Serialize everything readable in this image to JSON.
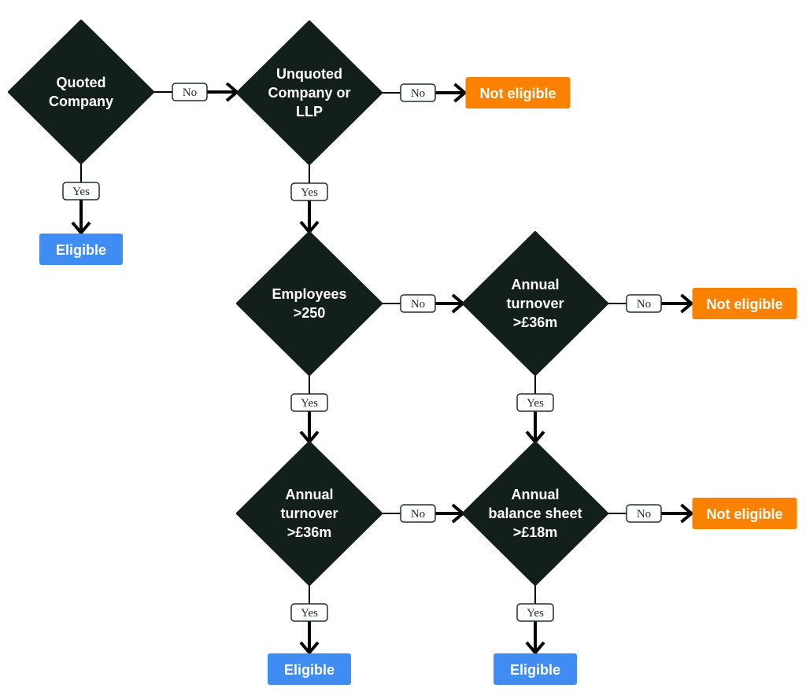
{
  "colors": {
    "decision": "#13201a",
    "eligible": "#3f8cf3",
    "not_eligible": "#fb8200",
    "connector": "#000000",
    "label_border": "#1e3328",
    "label_fill": "#ffffff"
  },
  "labels": {
    "yes": "Yes",
    "no": "No"
  },
  "nodes": [
    {
      "id": "quoted",
      "type": "decision",
      "lines": [
        "Quoted",
        "Company"
      ]
    },
    {
      "id": "unquoted",
      "type": "decision",
      "lines": [
        "Unquoted",
        "Company or",
        "LLP"
      ]
    },
    {
      "id": "employees",
      "type": "decision",
      "lines": [
        "Employees",
        ">250"
      ]
    },
    {
      "id": "turnover_right",
      "type": "decision",
      "lines": [
        "Annual",
        "turnover",
        ">£36m"
      ]
    },
    {
      "id": "turnover_left",
      "type": "decision",
      "lines": [
        "Annual",
        "turnover",
        ">£36m"
      ]
    },
    {
      "id": "balance",
      "type": "decision",
      "lines": [
        "Annual",
        "balance sheet",
        ">£18m"
      ]
    },
    {
      "id": "eligible_1",
      "type": "eligible",
      "label": "Eligible"
    },
    {
      "id": "not_eligible_1",
      "type": "not_eligible",
      "label": "Not eligible"
    },
    {
      "id": "not_eligible_2",
      "type": "not_eligible",
      "label": "Not eligible"
    },
    {
      "id": "not_eligible_3",
      "type": "not_eligible",
      "label": "Not eligible"
    },
    {
      "id": "eligible_2",
      "type": "eligible",
      "label": "Eligible"
    },
    {
      "id": "eligible_3",
      "type": "eligible",
      "label": "Eligible"
    }
  ],
  "edges": [
    {
      "from": "quoted",
      "to": "unquoted",
      "answer": "no"
    },
    {
      "from": "quoted",
      "to": "eligible_1",
      "answer": "yes"
    },
    {
      "from": "unquoted",
      "to": "not_eligible_1",
      "answer": "no"
    },
    {
      "from": "unquoted",
      "to": "employees",
      "answer": "yes"
    },
    {
      "from": "employees",
      "to": "turnover_right",
      "answer": "no"
    },
    {
      "from": "employees",
      "to": "turnover_left",
      "answer": "yes"
    },
    {
      "from": "turnover_right",
      "to": "not_eligible_2",
      "answer": "no"
    },
    {
      "from": "turnover_right",
      "to": "balance",
      "answer": "yes"
    },
    {
      "from": "turnover_left",
      "to": "balance",
      "answer": "no"
    },
    {
      "from": "turnover_left",
      "to": "eligible_2",
      "answer": "yes"
    },
    {
      "from": "balance",
      "to": "not_eligible_3",
      "answer": "no"
    },
    {
      "from": "balance",
      "to": "eligible_3",
      "answer": "yes"
    }
  ]
}
